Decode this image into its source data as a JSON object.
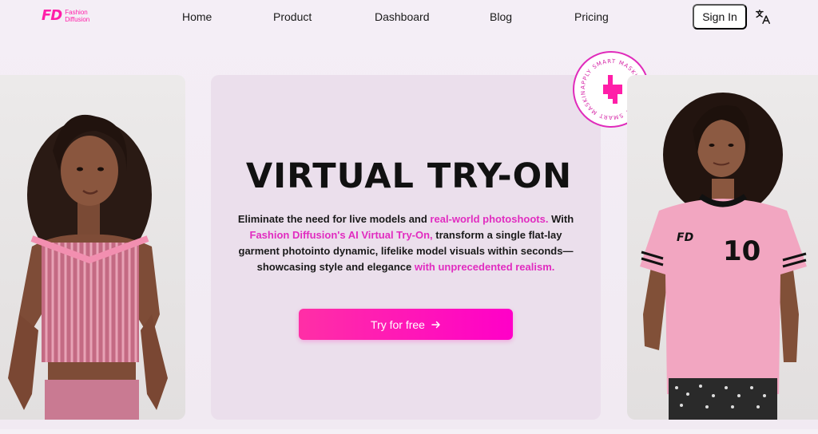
{
  "logo": {
    "mark": "FD",
    "line1": "Fashion",
    "line2": "Diffusion"
  },
  "nav": {
    "links": [
      "Home",
      "Product",
      "Dashboard",
      "Blog",
      "Pricing"
    ],
    "signin_label": "Sign In"
  },
  "hero": {
    "title": "VIRTUAL TRY-ON",
    "desc_1": "Eliminate the need for live models and ",
    "desc_hl_1": "real-world photoshoots.",
    "desc_2": " With ",
    "desc_hl_2": "Fashion Diffusion's AI Virtual Try-On,",
    "desc_3": " transform a single flat-lay garment photointo dynamic, lifelike model visuals within seconds—showcasing style and elegance ",
    "desc_hl_3": "with unprecedented realism.",
    "cta_label": "Try for free"
  },
  "badge": {
    "text": "APPLY SMART MASKING • APPLY SMART MASKING •"
  },
  "shirt": {
    "number": "10",
    "logo": "FD"
  },
  "colors": {
    "accent": "#ff1ea8",
    "highlight": "#e12cc0",
    "hero_bg": "#ebdfec"
  }
}
